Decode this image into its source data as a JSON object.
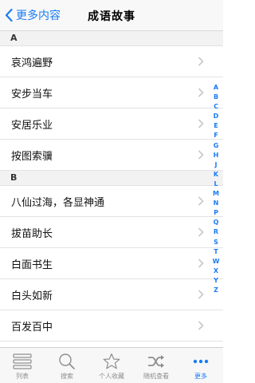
{
  "navbar": {
    "back_label": "更多内容",
    "title": "成语故事"
  },
  "sections": [
    {
      "header": "A",
      "rows": [
        "哀鸿遍野",
        "安步当车",
        "安居乐业",
        "按图索骥"
      ]
    },
    {
      "header": "B",
      "rows": [
        "八仙过海，各显神通",
        "拔苗助长",
        "白面书生",
        "白头如新",
        "百发百中"
      ]
    }
  ],
  "index_letters": [
    "A",
    "B",
    "C",
    "D",
    "E",
    "F",
    "G",
    "H",
    "J",
    "K",
    "L",
    "M",
    "N",
    "P",
    "Q",
    "R",
    "S",
    "T",
    "W",
    "X",
    "Y",
    "Z"
  ],
  "tabbar": {
    "tabs": [
      {
        "label": "列表",
        "icon": "list-icon"
      },
      {
        "label": "搜索",
        "icon": "search-icon"
      },
      {
        "label": "个人收藏",
        "icon": "star-icon"
      },
      {
        "label": "随机查看",
        "icon": "shuffle-icon"
      },
      {
        "label": "更多",
        "icon": "more-icon",
        "active": true
      }
    ]
  },
  "colors": {
    "accent": "#1a7cf4",
    "inactive": "#8e8e8e"
  }
}
